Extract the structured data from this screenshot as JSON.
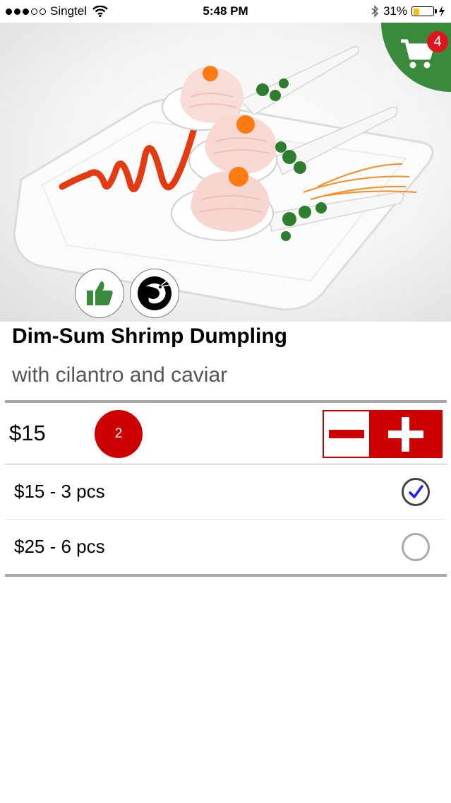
{
  "status_bar": {
    "carrier": "Singtel",
    "time": "5:48 PM",
    "battery": "31%",
    "battery_level": 0.31
  },
  "cart": {
    "count": "4"
  },
  "item": {
    "title": "Dim-Sum Shrimp Dumpling",
    "subtitle": "with cilantro and caviar",
    "price": "$15",
    "quantity": "2"
  },
  "options": [
    {
      "label": "$15 - 3 pcs",
      "selected": true
    },
    {
      "label": "$25 - 6 pcs",
      "selected": false
    }
  ],
  "colors": {
    "accent_red": "#cc0000",
    "cart_green": "#3a8a3c",
    "badge_red": "#e0151d",
    "check_blue": "#1a1aff"
  },
  "icons": [
    "wifi-icon",
    "bluetooth-icon",
    "charging-icon",
    "cart-icon",
    "thumbs-up-icon",
    "shrimp-icon",
    "minus-icon",
    "plus-icon",
    "checkmark-icon"
  ]
}
